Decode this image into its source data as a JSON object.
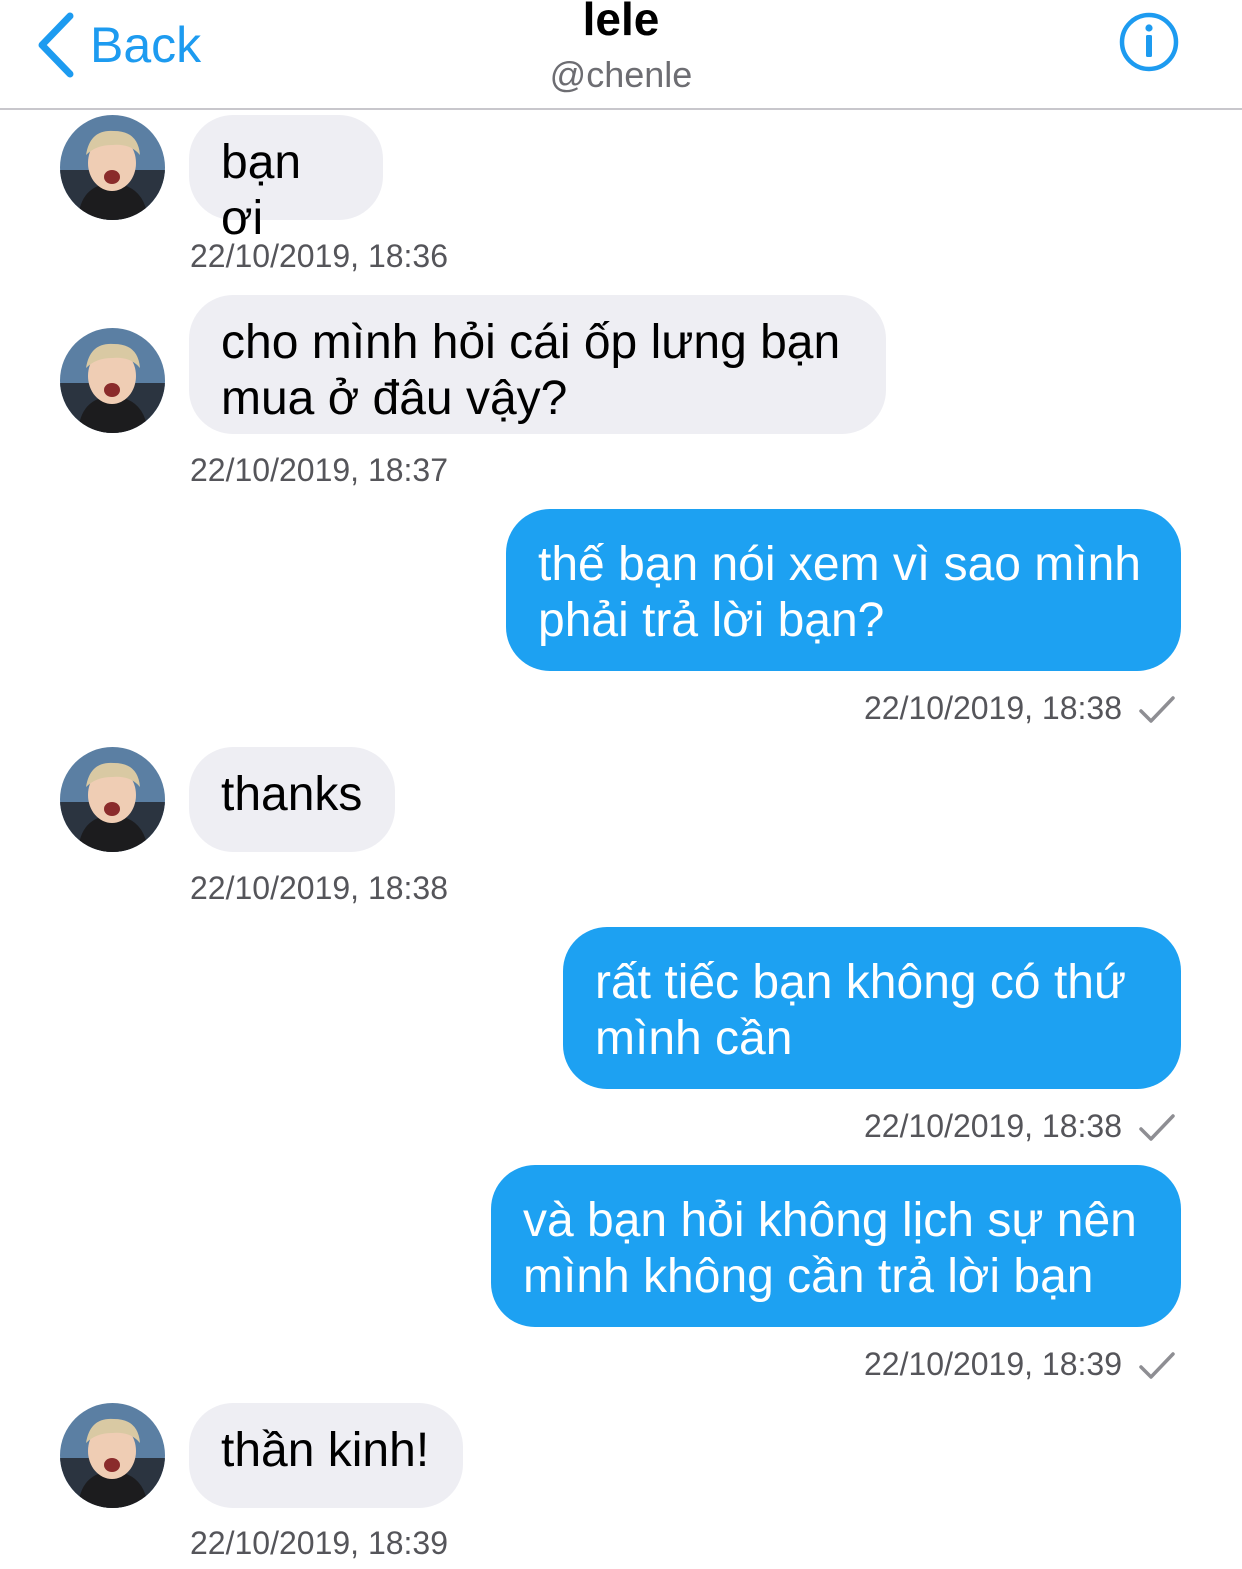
{
  "colors": {
    "accent": "#1d9bf0",
    "outgoing_bubble": "#1da1f2",
    "incoming_bubble": "#eeeef3"
  },
  "header": {
    "back_label": "Back",
    "back_icon": "chevron-left-icon",
    "title": "lele",
    "subtitle": "@chenle",
    "info_icon": "info-icon"
  },
  "messages": [
    {
      "dir": "in",
      "text": "bạn ơi",
      "time": "22/10/2019, 18:36"
    },
    {
      "dir": "in",
      "text": "cho mình hỏi cái ốp lưng bạn\nmua ở đâu vậy?",
      "time": "22/10/2019, 18:37"
    },
    {
      "dir": "out",
      "text": "thế bạn nói xem vì sao mình\nphải trả lời bạn?",
      "time": "22/10/2019, 18:38",
      "status_icon": "checkmark-icon"
    },
    {
      "dir": "in",
      "text": "thanks",
      "time": "22/10/2019, 18:38"
    },
    {
      "dir": "out",
      "text": "rất tiếc bạn không có thứ\nmình cần",
      "time": "22/10/2019, 18:38",
      "status_icon": "checkmark-icon"
    },
    {
      "dir": "out",
      "text": "và bạn hỏi không lịch sự nên\nmình không cần trả lời bạn",
      "time": "22/10/2019, 18:39",
      "status_icon": "checkmark-icon"
    },
    {
      "dir": "in",
      "text": "thần kinh!",
      "time": "22/10/2019, 18:39"
    }
  ]
}
